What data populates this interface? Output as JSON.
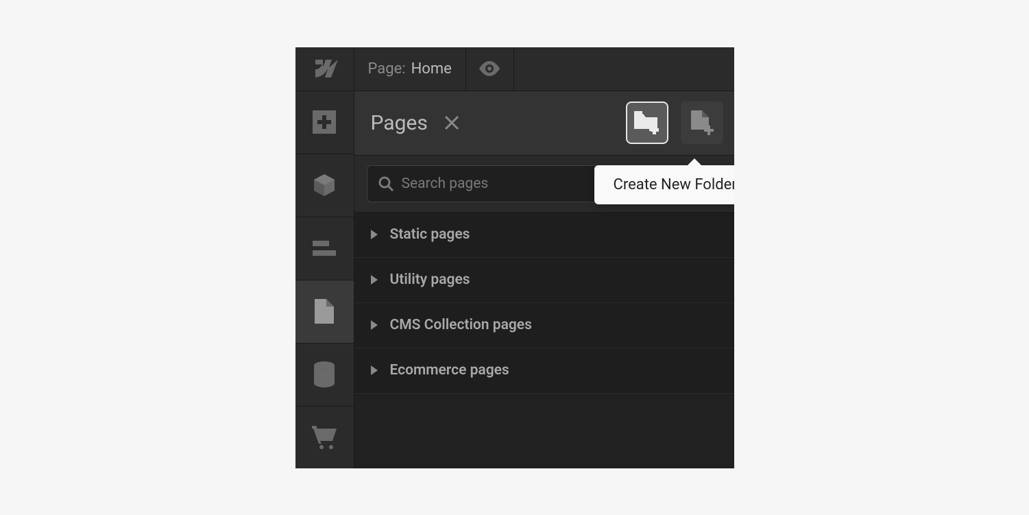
{
  "topbar": {
    "page_label_prefix": "Page:",
    "page_name": "Home"
  },
  "panel": {
    "title": "Pages",
    "search_placeholder": "Search pages",
    "tooltip": "Create New Folder",
    "groups": [
      {
        "label": "Static pages"
      },
      {
        "label": "Utility pages"
      },
      {
        "label": "CMS Collection pages"
      },
      {
        "label": "Ecommerce pages"
      }
    ]
  }
}
